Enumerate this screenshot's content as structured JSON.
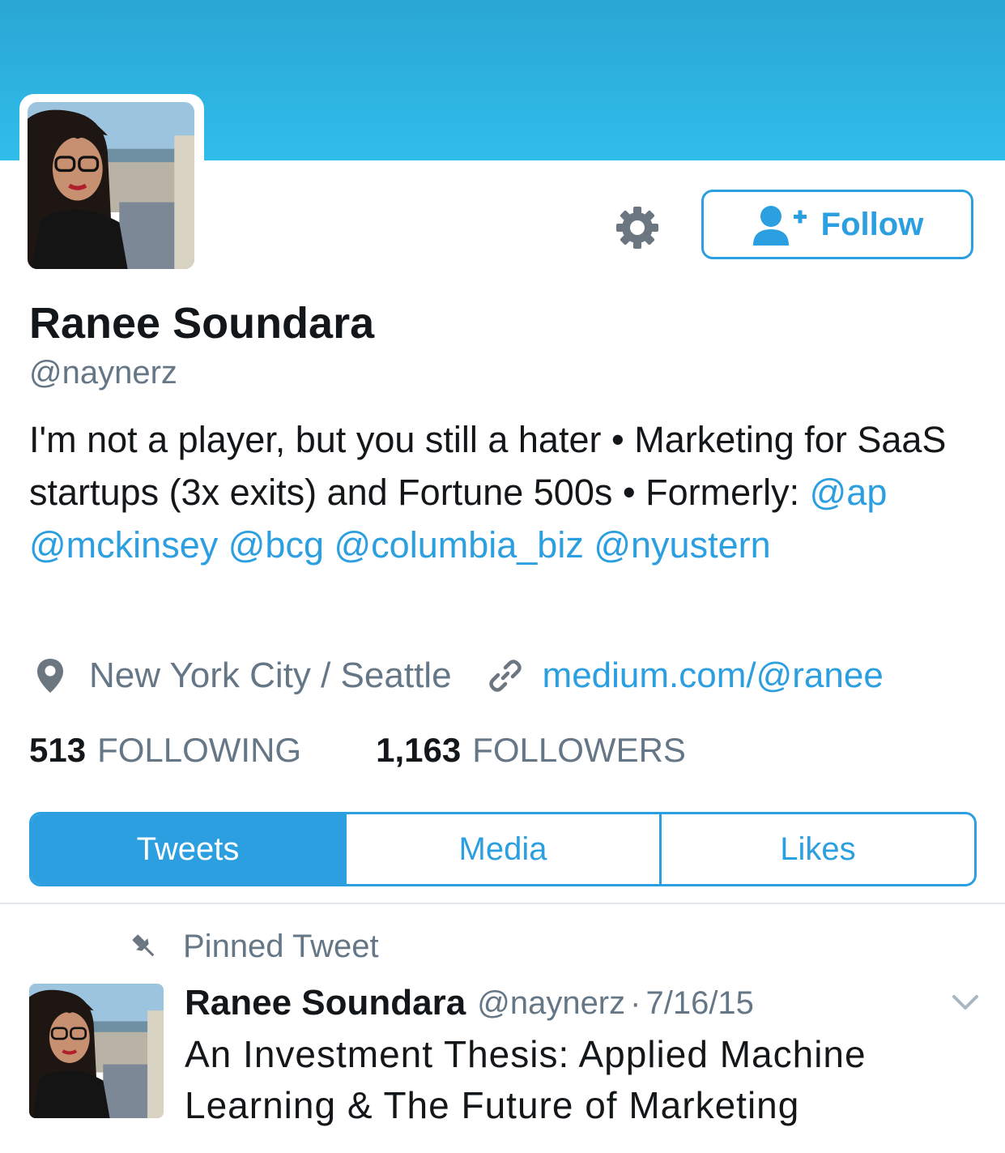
{
  "profile": {
    "name": "Ranee Soundara",
    "handle": "@naynerz",
    "bio_text_1": "I'm not a player, but you still a hater • Marketing for SaaS startups (3x exits) and Fortune 500s • Formerly: ",
    "bio_mentions": [
      "@ap",
      "@mckinsey",
      "@bcg",
      "@columbia_biz",
      "@nyustern"
    ],
    "location": "New York City / Seattle",
    "website": "medium.com/@ranee"
  },
  "actions": {
    "settings_icon": "gear-icon",
    "follow_label": "Follow",
    "follow_icon": "add-user-icon"
  },
  "stats": {
    "following_count": "513",
    "following_label": "FOLLOWING",
    "followers_count": "1,163",
    "followers_label": "FOLLOWERS"
  },
  "tabs": [
    {
      "label": "Tweets",
      "active": true
    },
    {
      "label": "Media",
      "active": false
    },
    {
      "label": "Likes",
      "active": false
    }
  ],
  "pinned_tweet": {
    "label": "Pinned Tweet",
    "name": "Ranee Soundara",
    "handle": "@naynerz",
    "separator": "·",
    "date": "7/16/15",
    "text": "An Investment Thesis: Applied Machine Learning & The Future of Marketing"
  },
  "colors": {
    "accent": "#2b9fe0",
    "banner": "#30bdea",
    "secondary_text": "#657786"
  }
}
